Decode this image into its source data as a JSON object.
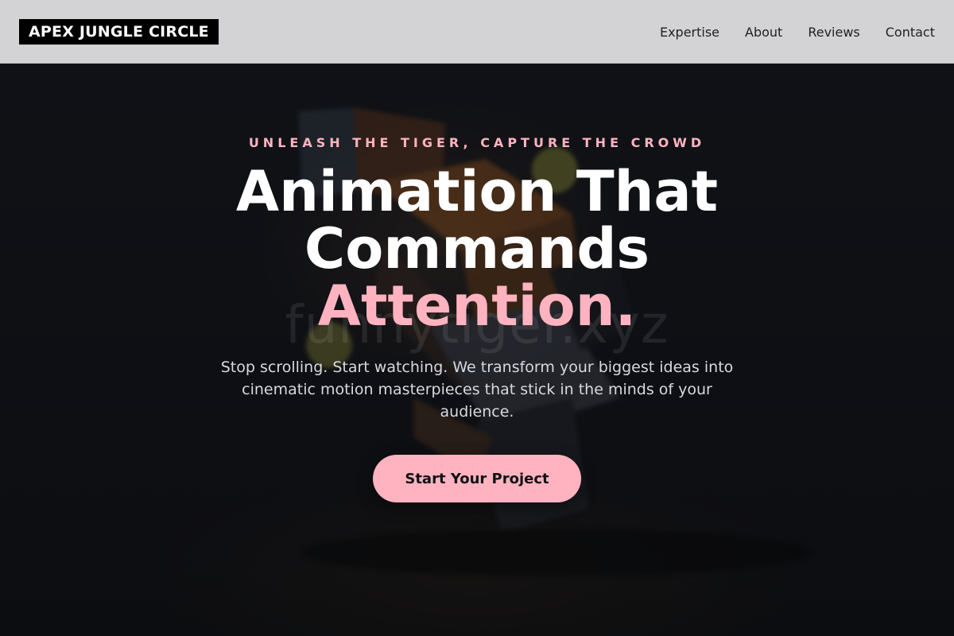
{
  "header": {
    "logo": "APEX JUNGLE CIRCLE",
    "nav": [
      {
        "label": "Expertise"
      },
      {
        "label": "About"
      },
      {
        "label": "Reviews"
      },
      {
        "label": "Contact"
      }
    ]
  },
  "hero": {
    "watermark": "funnytiger.xyz",
    "eyebrow": "UNLEASH THE TIGER, CAPTURE THE CROWD",
    "headline": {
      "line1": "Animation That",
      "line2": "Commands",
      "accent": "Attention."
    },
    "subtext": "Stop scrolling. Start watching. We transform your biggest ideas into cinematic motion masterpieces that stick in the minds of your audience.",
    "cta_label": "Start Your Project"
  },
  "colors": {
    "accent_pink": "#ffb3c0",
    "header_bg": "#d3d3d5",
    "hero_bg": "#111217",
    "logo_bg": "#000000"
  }
}
